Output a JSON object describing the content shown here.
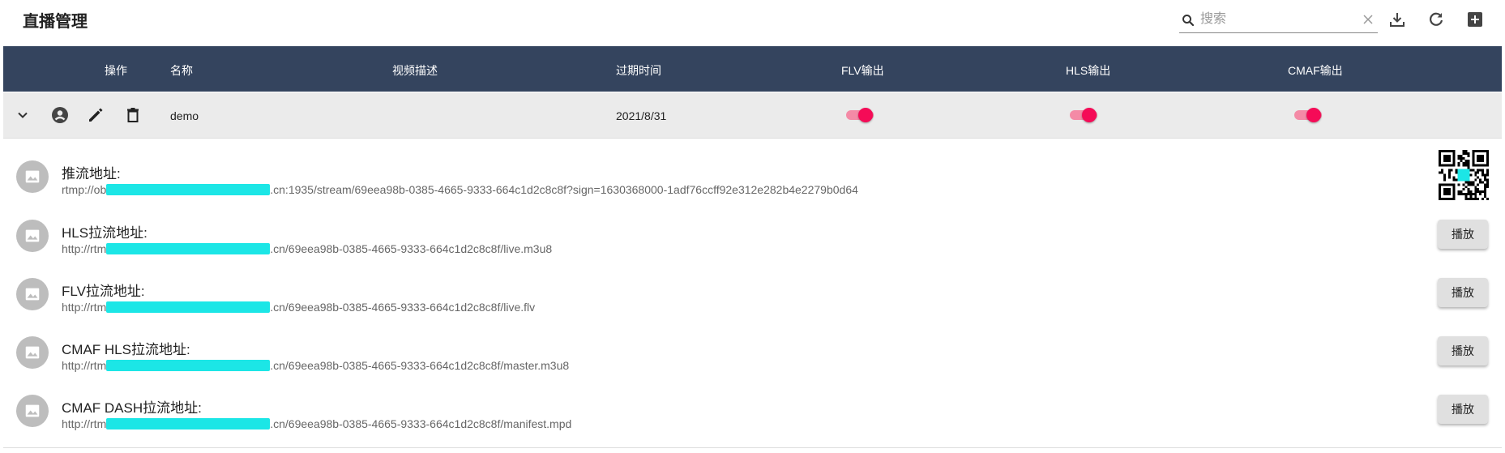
{
  "header": {
    "title": "直播管理",
    "search_placeholder": "搜索",
    "search_value": ""
  },
  "icons": {
    "search": "search-icon",
    "clear": "close-icon",
    "download": "download-icon",
    "refresh": "refresh-icon",
    "add": "add-box-icon",
    "expand": "chevron-down-icon",
    "account": "account-circle-icon",
    "edit": "pencil-icon",
    "delete": "trash-icon",
    "image": "image-icon"
  },
  "table": {
    "headers": {
      "actions": "操作",
      "name": "名称",
      "description": "视频描述",
      "expire": "过期时间",
      "flv": "FLV输出",
      "hls": "HLS输出",
      "cmaf": "CMAF输出"
    },
    "row": {
      "name": "demo",
      "description": "",
      "expire": "2021/8/31",
      "flv_enabled": true,
      "hls_enabled": true,
      "cmaf_enabled": true
    }
  },
  "details": [
    {
      "label": "推流地址:",
      "url_prefix": "rtmp://ob",
      "url_suffix": ".cn:1935/stream/69eea98b-0385-4665-9333-664c1d2c8c8f?sign=1630368000-1adf76ccff92e312e282b4e2279b0d64",
      "action": "qr"
    },
    {
      "label": "HLS拉流地址:",
      "url_prefix": "http://rtm",
      "url_suffix": ".cn/69eea98b-0385-4665-9333-664c1d2c8c8f/live.m3u8",
      "action": "播放"
    },
    {
      "label": "FLV拉流地址:",
      "url_prefix": "http://rtm",
      "url_suffix": ".cn/69eea98b-0385-4665-9333-664c1d2c8c8f/live.flv",
      "action": "播放"
    },
    {
      "label": "CMAF HLS拉流地址:",
      "url_prefix": "http://rtm",
      "url_suffix": ".cn/69eea98b-0385-4665-9333-664c1d2c8c8f/master.m3u8",
      "action": "播放"
    },
    {
      "label": "CMAF DASH拉流地址:",
      "url_prefix": "http://rtm",
      "url_suffix": ".cn/69eea98b-0385-4665-9333-664c1d2c8c8f/manifest.mpd",
      "action": "播放"
    }
  ],
  "colors": {
    "header_bg": "#34445e",
    "row_bg": "#ebebeb",
    "switch_on": "#f50b57",
    "redaction": "#1ce6e6"
  }
}
